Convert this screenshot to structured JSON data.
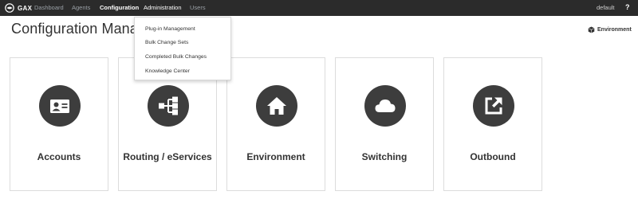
{
  "topbar": {
    "logo_text": "GAX",
    "nav": [
      {
        "label": "Dashboard"
      },
      {
        "label": "Agents"
      },
      {
        "label": "Configuration"
      },
      {
        "label": "Administration"
      },
      {
        "label": "Users"
      }
    ],
    "user": "default",
    "help": "?"
  },
  "page": {
    "title": "Configuration Manager",
    "environment_label": "Environment"
  },
  "dropdown": {
    "items": [
      {
        "label": "Plug-in Management"
      },
      {
        "label": "Bulk Change Sets"
      },
      {
        "label": "Completed Bulk Changes"
      },
      {
        "label": "Knowledge Center"
      }
    ]
  },
  "tiles": [
    {
      "label": "Accounts",
      "icon": "id-card-icon"
    },
    {
      "label": "Routing / eServices",
      "icon": "routing-icon"
    },
    {
      "label": "Environment",
      "icon": "home-icon"
    },
    {
      "label": "Switching",
      "icon": "cloud-icon"
    },
    {
      "label": "Outbound",
      "icon": "external-link-icon"
    }
  ],
  "colors": {
    "topbar_bg": "#2b2b2b",
    "icon_circle": "#3d3d3d",
    "tile_border": "#dcdcdc"
  }
}
